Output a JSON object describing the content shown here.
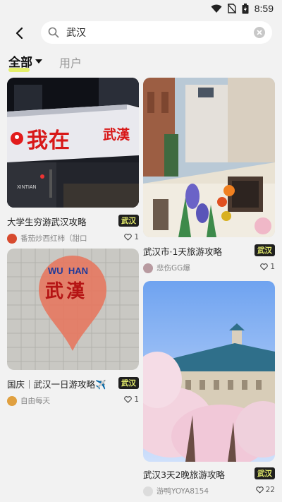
{
  "status": {
    "time": "8:59"
  },
  "search": {
    "value": "武汉"
  },
  "tabs": {
    "all": "全部",
    "user": "用户"
  },
  "cards": [
    {
      "title": "大学生穷游武汉攻略",
      "tag": "武汉",
      "author": "番茄炒西红柿（甜口",
      "likes": "1",
      "sign": {
        "word1": "我在",
        "word2": "武漢",
        "brand": "XINTIAN"
      }
    },
    {
      "title": "武汉市·1天旅游攻略",
      "tag": "武汉",
      "author": "悲伤GG爆",
      "likes": "1"
    },
    {
      "title": "国庆｜武汉一日游攻略✈️",
      "tag": "武汉",
      "author": "自由每天",
      "likes": "1",
      "pin": {
        "top": "WU  HAN",
        "main": "武漢"
      }
    },
    {
      "title": "武汉3天2晚旅游攻略",
      "tag": "武汉",
      "author": "游鸭YOYA8154",
      "likes": "22"
    }
  ]
}
